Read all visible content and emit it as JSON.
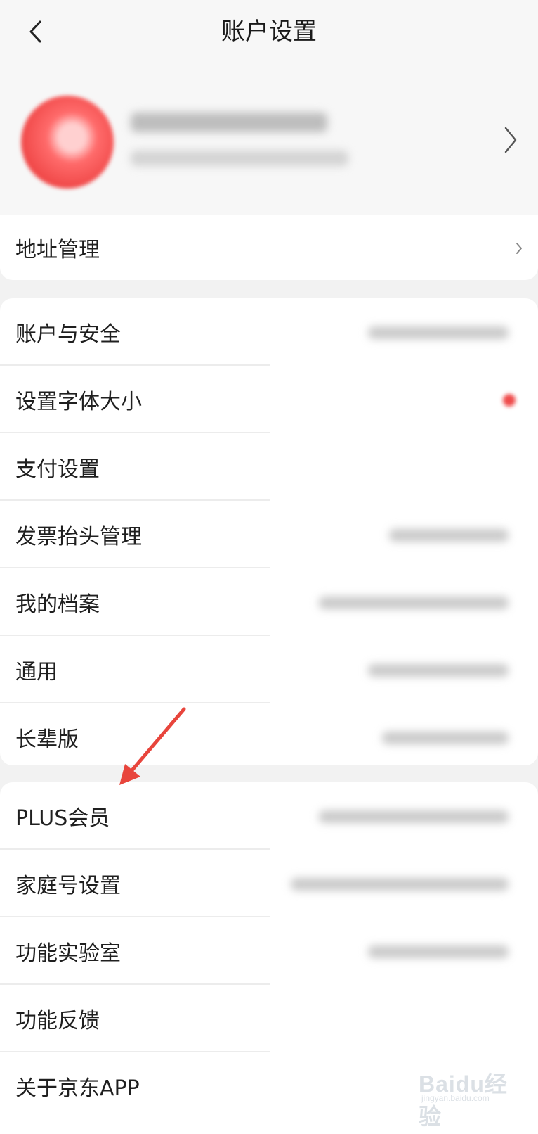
{
  "header": {
    "title": "账户设置",
    "back_icon": "chevron-left-icon"
  },
  "profile": {
    "avatar_color": "#f04848",
    "chevron_icon": "chevron-right-icon"
  },
  "address_card": {
    "items": [
      {
        "label": "地址管理"
      }
    ]
  },
  "settings_card": {
    "items": [
      {
        "label": "账户与安全"
      },
      {
        "label": "设置字体大小"
      },
      {
        "label": "支付设置"
      },
      {
        "label": "发票抬头管理"
      },
      {
        "label": "我的档案"
      },
      {
        "label": "通用"
      },
      {
        "label": "长辈版"
      }
    ]
  },
  "more_card": {
    "items": [
      {
        "label": "PLUS会员"
      },
      {
        "label": "家庭号设置"
      },
      {
        "label": "功能实验室"
      },
      {
        "label": "功能反馈"
      },
      {
        "label": "关于京东APP"
      }
    ]
  },
  "annotation": {
    "arrow_color": "#e8453c"
  },
  "watermark": {
    "text": "Baidu经验",
    "subtext": "jingyan.baidu.com"
  }
}
